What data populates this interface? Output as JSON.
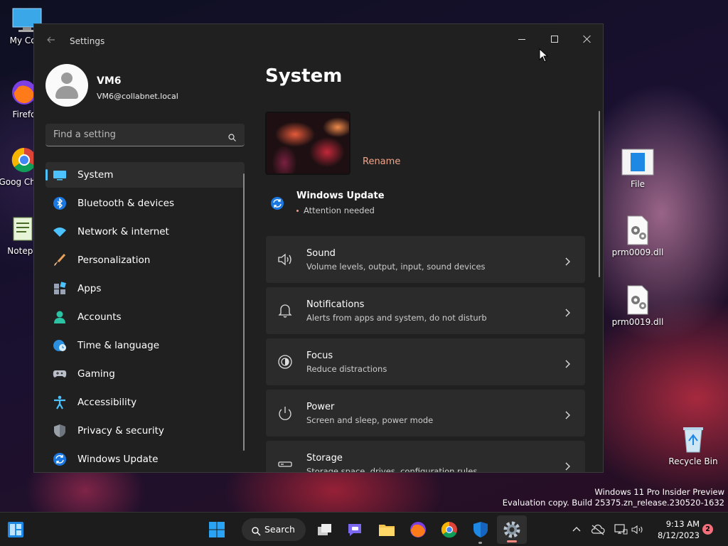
{
  "desktop": {
    "icons": [
      {
        "label": "My Com"
      },
      {
        "label": "Firefo"
      },
      {
        "label": "Goog Chron"
      },
      {
        "label": "Notepa"
      },
      {
        "label": "File"
      },
      {
        "label": "prm0009.dll"
      },
      {
        "label": "prm0019.dll"
      },
      {
        "label": "Recycle Bin"
      }
    ]
  },
  "window": {
    "title": "Settings",
    "user": {
      "name": "VM6",
      "email": "VM6@collabnet.local"
    },
    "search": {
      "placeholder": "Find a setting"
    },
    "nav": [
      {
        "label": "System",
        "icon": "monitor-icon",
        "active": true
      },
      {
        "label": "Bluetooth & devices",
        "icon": "bluetooth-icon"
      },
      {
        "label": "Network & internet",
        "icon": "wifi-icon"
      },
      {
        "label": "Personalization",
        "icon": "brush-icon"
      },
      {
        "label": "Apps",
        "icon": "apps-icon"
      },
      {
        "label": "Accounts",
        "icon": "account-icon"
      },
      {
        "label": "Time & language",
        "icon": "globe-clock-icon"
      },
      {
        "label": "Gaming",
        "icon": "gamepad-icon"
      },
      {
        "label": "Accessibility",
        "icon": "accessibility-icon"
      },
      {
        "label": "Privacy & security",
        "icon": "shield-icon"
      },
      {
        "label": "Windows Update",
        "icon": "update-icon"
      }
    ],
    "main": {
      "title": "System",
      "rename_label": "Rename",
      "update": {
        "title": "Windows Update",
        "status": "Attention needed"
      },
      "cards": [
        {
          "title": "Sound",
          "subtitle": "Volume levels, output, input, sound devices",
          "icon": "speaker-icon"
        },
        {
          "title": "Notifications",
          "subtitle": "Alerts from apps and system, do not disturb",
          "icon": "bell-icon"
        },
        {
          "title": "Focus",
          "subtitle": "Reduce distractions",
          "icon": "focus-icon"
        },
        {
          "title": "Power",
          "subtitle": "Screen and sleep, power mode",
          "icon": "power-icon"
        },
        {
          "title": "Storage",
          "subtitle": "Storage space, drives, configuration rules",
          "icon": "storage-icon"
        }
      ]
    }
  },
  "watermark": {
    "line1": "Windows 11 Pro Insider Preview",
    "line2": "Evaluation copy. Build 25375.zn_release.230520-1632"
  },
  "taskbar": {
    "search_label": "Search",
    "time": "9:13 AM",
    "date": "8/12/2023",
    "notification_count": "2"
  },
  "colors": {
    "accent": "#4cc2ff",
    "rename": "#f0a58a",
    "badge": "#f1707b"
  }
}
